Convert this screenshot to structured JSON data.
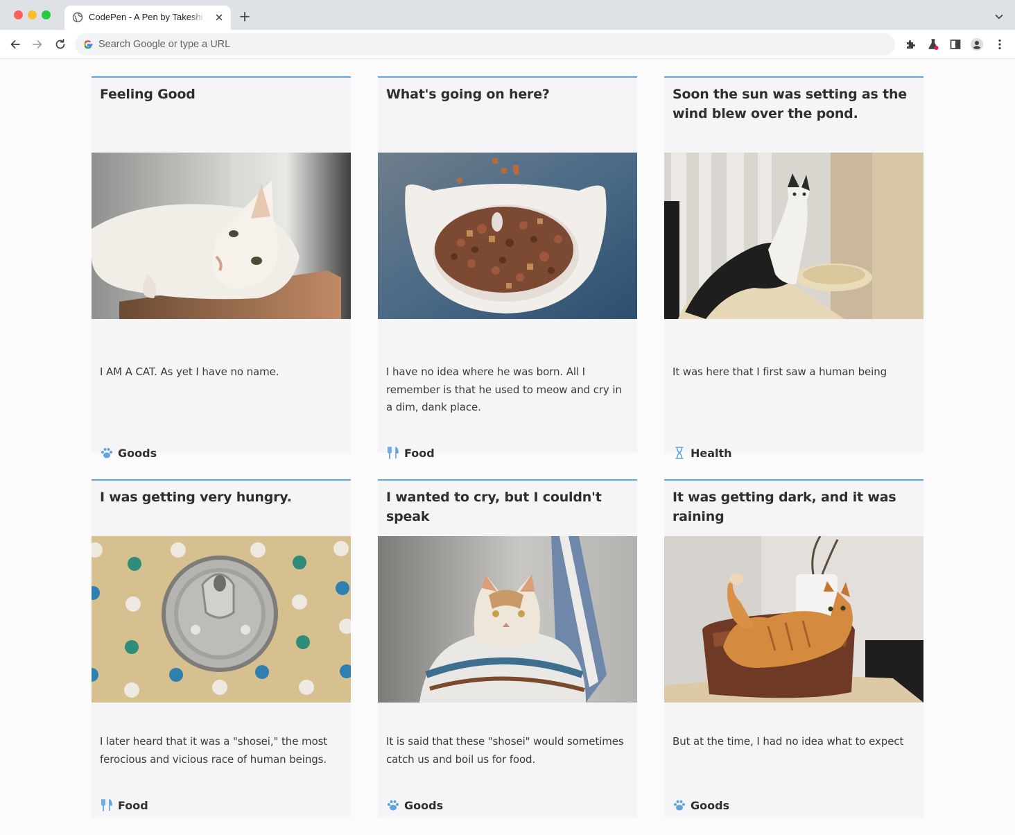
{
  "browser": {
    "tab_title": "CodePen - A Pen by Takeshi K",
    "omnibox_placeholder": "Search Google or type a URL"
  },
  "cards": [
    {
      "title": "Feeling Good",
      "image": "white-cat-lying-on-box",
      "text": "I AM A CAT. As yet I have no name.",
      "category": "Goods",
      "category_icon": "paw-icon"
    },
    {
      "title": "What's going on here?",
      "image": "cat-food-bowl",
      "text": "I have no idea where he was born. All I remember is that he used to meow and cry in a dim, dank place.",
      "category": "Food",
      "category_icon": "utensils-icon"
    },
    {
      "title": "Soon the sun was setting as the wind blew over the pond.",
      "image": "cat-on-cat-tower",
      "text": "It was here that I first saw a human being",
      "category": "Health",
      "category_icon": "hourglass-icon"
    },
    {
      "title": "I was getting very hungry.",
      "image": "cat-food-can-on-polka-dots",
      "text": "I later heard that it was a \"shosei,\" the most ferocious and vicious race of human beings.",
      "category": "Food",
      "category_icon": "utensils-icon"
    },
    {
      "title": "I wanted to cry, but I couldn't speak",
      "image": "cat-wrapped-in-towel",
      "text": "It is said that these \"shosei\" would sometimes catch us and boil us for food.",
      "category": "Goods",
      "category_icon": "paw-icon"
    },
    {
      "title": "It was getting dark, and it was raining",
      "image": "orange-cat-in-pot",
      "text": "But at the time, I had no idea what to expect",
      "category": "Goods",
      "category_icon": "paw-icon"
    }
  ],
  "colors": {
    "accent": "#5fa5e2",
    "card_bg": "#f5f4f6",
    "text": "#2f2f2f"
  }
}
